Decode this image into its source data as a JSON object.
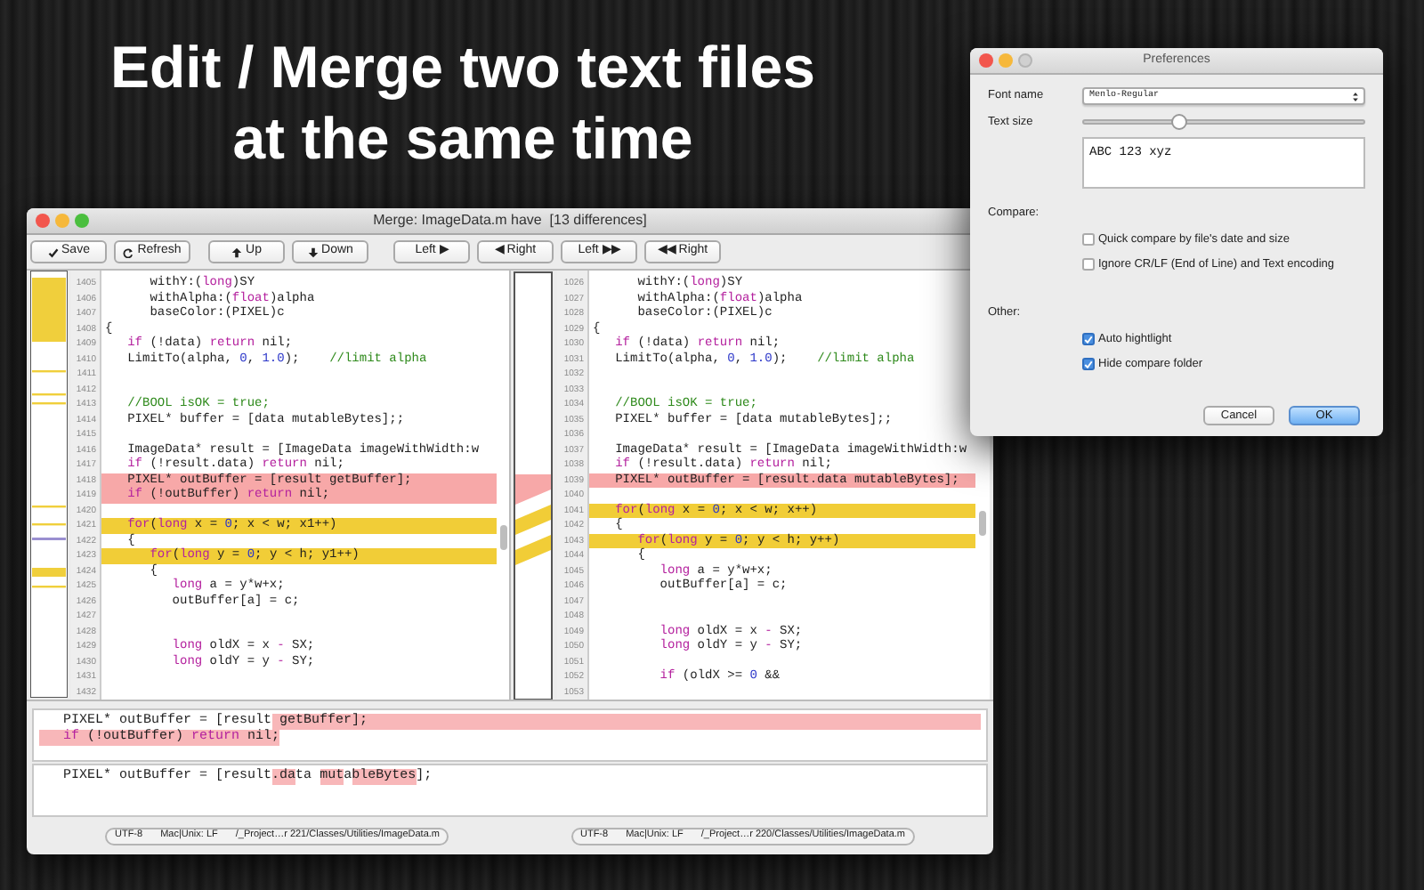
{
  "headline": [
    "Edit / Merge two text files",
    "at the same time"
  ],
  "window": {
    "title": "Merge: ImageData.m have  [13 differences]",
    "toolbar": [
      {
        "label": "Save"
      },
      {
        "label": "Refresh"
      },
      {
        "label": "Up"
      },
      {
        "label": "Down"
      },
      {
        "label": "Left ▶"
      },
      {
        "label": "◀ Right"
      },
      {
        "label": "Left ▶▶"
      },
      {
        "label": "◀◀ Right"
      }
    ],
    "left_pane": {
      "lines": [
        {
          "no": "1405",
          "code": [
            {
              "text": "      withY:("
            },
            {
              "text": "long",
              "kind": "keyword"
            },
            {
              "text": ")SY"
            }
          ]
        },
        {
          "no": "1406",
          "code": [
            {
              "text": "      withAlpha:("
            },
            {
              "text": "float",
              "kind": "keyword"
            },
            {
              "text": ")alpha"
            }
          ]
        },
        {
          "no": "1407",
          "code": [
            {
              "text": "      baseColor:(PIXEL)c"
            }
          ]
        },
        {
          "no": "1408",
          "code": [
            {
              "text": "{"
            }
          ]
        },
        {
          "no": "1409",
          "code": [
            {
              "text": "   if",
              "kind": "keyword"
            },
            {
              "text": " (!data) "
            },
            {
              "text": "return",
              "kind": "keyword"
            },
            {
              "text": " nil;"
            }
          ]
        },
        {
          "no": "1410",
          "code": [
            {
              "text": "   LimitTo(alpha, "
            },
            {
              "text": "0",
              "kind": "number"
            },
            {
              "text": ", "
            },
            {
              "text": "1.0",
              "kind": "number"
            },
            {
              "text": ");    "
            },
            {
              "text": "//limit alpha",
              "kind": "comment"
            }
          ]
        },
        {
          "no": "1411"
        },
        {
          "no": "1412"
        },
        {
          "no": "1413",
          "code": [
            {
              "text": "   //BOOL isOK = true;",
              "kind": "comment"
            }
          ]
        },
        {
          "no": "1414",
          "code": [
            {
              "text": "   PIXEL* buffer = [data mutableBytes];;"
            }
          ]
        },
        {
          "no": "1415"
        },
        {
          "no": "1416",
          "code": [
            {
              "text": "   ImageData* result = [ImageData imageWithWidth:w"
            }
          ]
        },
        {
          "no": "1417",
          "code": [
            {
              "text": "   if",
              "kind": "keyword"
            },
            {
              "text": " (!result.data) "
            },
            {
              "text": "return",
              "kind": "keyword"
            },
            {
              "text": " nil;"
            }
          ]
        },
        {
          "no": "1418",
          "kind": "removed",
          "code": [
            {
              "text": "   PIXEL* outBuffer = [result getBuffer];"
            }
          ]
        },
        {
          "no": "1419",
          "kind": "removed",
          "code": [
            {
              "text": "   if",
              "kind": "keyword"
            },
            {
              "text": " (!outBuffer) "
            },
            {
              "text": "return",
              "kind": "keyword"
            },
            {
              "text": " nil;"
            }
          ]
        },
        {
          "no": "1420"
        },
        {
          "no": "1421",
          "kind": "changed",
          "code": [
            {
              "text": "   for",
              "kind": "keyword"
            },
            {
              "text": "("
            },
            {
              "text": "long",
              "kind": "keyword"
            },
            {
              "text": " x = "
            },
            {
              "text": "0",
              "kind": "number"
            },
            {
              "text": "; x < w; x1++)"
            }
          ]
        },
        {
          "no": "1422",
          "code": [
            {
              "text": "   {"
            }
          ]
        },
        {
          "no": "1423",
          "kind": "changed",
          "code": [
            {
              "text": "      for",
              "kind": "keyword"
            },
            {
              "text": "("
            },
            {
              "text": "long",
              "kind": "keyword"
            },
            {
              "text": " y = "
            },
            {
              "text": "0",
              "kind": "number"
            },
            {
              "text": "; y < h; y1++)"
            }
          ]
        },
        {
          "no": "1424",
          "code": [
            {
              "text": "      {"
            }
          ]
        },
        {
          "no": "1425",
          "code": [
            {
              "text": "         long",
              "kind": "keyword"
            },
            {
              "text": " a = y*w+x;"
            }
          ]
        },
        {
          "no": "1426",
          "code": [
            {
              "text": "         outBuffer[a] = c;"
            }
          ]
        },
        {
          "no": "1427"
        },
        {
          "no": "1428"
        },
        {
          "no": "1429",
          "code": [
            {
              "text": "         long",
              "kind": "keyword"
            },
            {
              "text": " oldX = x "
            },
            {
              "text": "-",
              "kind": "keyword"
            },
            {
              "text": " SX;"
            }
          ]
        },
        {
          "no": "1430",
          "code": [
            {
              "text": "         long",
              "kind": "keyword"
            },
            {
              "text": " oldY = y "
            },
            {
              "text": "-",
              "kind": "keyword"
            },
            {
              "text": " SY;"
            }
          ]
        },
        {
          "no": "1431"
        },
        {
          "no": "1432"
        }
      ]
    },
    "right_pane": {
      "lines": [
        {
          "no": "1026",
          "code": [
            {
              "text": "      withY:("
            },
            {
              "text": "long",
              "kind": "keyword"
            },
            {
              "text": ")SY"
            }
          ]
        },
        {
          "no": "1027",
          "code": [
            {
              "text": "      withAlpha:("
            },
            {
              "text": "float",
              "kind": "keyword"
            },
            {
              "text": ")alpha"
            }
          ]
        },
        {
          "no": "1028",
          "code": [
            {
              "text": "      baseColor:(PIXEL)c"
            }
          ]
        },
        {
          "no": "1029",
          "code": [
            {
              "text": "{"
            }
          ]
        },
        {
          "no": "1030",
          "code": [
            {
              "text": "   if",
              "kind": "keyword"
            },
            {
              "text": " (!data) "
            },
            {
              "text": "return",
              "kind": "keyword"
            },
            {
              "text": " nil;"
            }
          ]
        },
        {
          "no": "1031",
          "code": [
            {
              "text": "   LimitTo(alpha, "
            },
            {
              "text": "0",
              "kind": "number"
            },
            {
              "text": ", "
            },
            {
              "text": "1.0",
              "kind": "number"
            },
            {
              "text": ");    "
            },
            {
              "text": "//limit alpha",
              "kind": "comment"
            }
          ]
        },
        {
          "no": "1032"
        },
        {
          "no": "1033"
        },
        {
          "no": "1034",
          "code": [
            {
              "text": "   //BOOL isOK = true;",
              "kind": "comment"
            }
          ]
        },
        {
          "no": "1035",
          "code": [
            {
              "text": "   PIXEL* buffer = [data mutableBytes];;"
            }
          ]
        },
        {
          "no": "1036"
        },
        {
          "no": "1037",
          "code": [
            {
              "text": "   ImageData* result = [ImageData imageWithWidth:w"
            }
          ]
        },
        {
          "no": "1038",
          "code": [
            {
              "text": "   if",
              "kind": "keyword"
            },
            {
              "text": " (!result.data) "
            },
            {
              "text": "return",
              "kind": "keyword"
            },
            {
              "text": " nil;"
            }
          ]
        },
        {
          "no": "1039",
          "kind": "removed",
          "code": [
            {
              "text": "   PIXEL* outBuffer = [result.data mutableBytes];"
            }
          ]
        },
        {
          "no": "1040"
        },
        {
          "no": "1041",
          "kind": "changed",
          "code": [
            {
              "text": "   for",
              "kind": "keyword"
            },
            {
              "text": "("
            },
            {
              "text": "long",
              "kind": "keyword"
            },
            {
              "text": " x = "
            },
            {
              "text": "0",
              "kind": "number"
            },
            {
              "text": "; x < w; x++)"
            }
          ]
        },
        {
          "no": "1042",
          "code": [
            {
              "text": "   {"
            }
          ]
        },
        {
          "no": "1043",
          "kind": "changed",
          "code": [
            {
              "text": "      for",
              "kind": "keyword"
            },
            {
              "text": "("
            },
            {
              "text": "long",
              "kind": "keyword"
            },
            {
              "text": " y = "
            },
            {
              "text": "0",
              "kind": "number"
            },
            {
              "text": "; y < h; y++)"
            }
          ]
        },
        {
          "no": "1044",
          "code": [
            {
              "text": "      {"
            }
          ]
        },
        {
          "no": "1045",
          "code": [
            {
              "text": "         long",
              "kind": "keyword"
            },
            {
              "text": " a = y*w+x;"
            }
          ]
        },
        {
          "no": "1046",
          "code": [
            {
              "text": "         outBuffer[a] = c;"
            }
          ]
        },
        {
          "no": "1047"
        },
        {
          "no": "1048"
        },
        {
          "no": "1049",
          "code": [
            {
              "text": "         long",
              "kind": "keyword"
            },
            {
              "text": " oldX = x "
            },
            {
              "text": "-",
              "kind": "keyword"
            },
            {
              "text": " SX;"
            }
          ]
        },
        {
          "no": "1050",
          "code": [
            {
              "text": "         long",
              "kind": "keyword"
            },
            {
              "text": " oldY = y "
            },
            {
              "text": "-",
              "kind": "keyword"
            },
            {
              "text": " SY;"
            }
          ]
        },
        {
          "no": "1051"
        },
        {
          "no": "1052",
          "code": [
            {
              "text": "         if",
              "kind": "keyword"
            },
            {
              "text": " (oldX >= "
            },
            {
              "text": "0",
              "kind": "number"
            },
            {
              "text": " &&"
            }
          ]
        },
        {
          "no": "1053"
        }
      ]
    },
    "detail_panes": [
      {
        "lines": [
          {
            "highlighted_to_end": true,
            "code": [
              {
                "text": "   PIXEL* outBuffer = [result"
              },
              {
                "text": " getBuffer];",
                "highlighted": true
              }
            ]
          },
          {
            "code": [
              {
                "text": "   if",
                "kind": "keyword",
                "highlighted": true
              },
              {
                "text": " (!outBuffer) ",
                "highlighted": true
              },
              {
                "text": "return",
                "kind": "keyword",
                "highlighted": true
              },
              {
                "text": " nil;",
                "highlighted": true
              }
            ]
          }
        ]
      },
      {
        "lines": [
          {
            "code": [
              {
                "text": "   PIXEL* outBuffer = [result"
              },
              {
                "text": ".da",
                "highlighted": true
              },
              {
                "text": "ta "
              },
              {
                "text": "mut",
                "highlighted": true
              },
              {
                "text": "a"
              },
              {
                "text": "bleBytes",
                "highlighted": true
              },
              {
                "text": "];"
              }
            ]
          }
        ]
      }
    ],
    "status_bars": [
      {
        "encoding": "UTF-8",
        "line_endings": "Mac|Unix: LF",
        "path": "/_Project…r 221/Classes/Utilities/ImageData.m"
      },
      {
        "encoding": "UTF-8",
        "line_endings": "Mac|Unix: LF",
        "path": "/_Project…r 220/Classes/Utilities/ImageData.m"
      }
    ]
  },
  "preferences": {
    "title": "Preferences",
    "font_name": {
      "label": "Font name",
      "value": "Menlo-Regular"
    },
    "text_size": {
      "label": "Text size",
      "level": 0.34
    },
    "preview": "ABC 123 xyz",
    "sections": [
      {
        "label": "Compare:",
        "options": [
          {
            "label": "Quick compare by file's date and size",
            "checked": false
          },
          {
            "label": "Ignore CR/LF (End of Line) and Text encoding",
            "checked": false
          }
        ]
      },
      {
        "label": "Other:",
        "options": [
          {
            "label": "Auto hightlight",
            "checked": true
          },
          {
            "label": "Hide compare folder",
            "checked": true
          }
        ]
      }
    ],
    "buttons": [
      {
        "label": "Cancel",
        "default": false
      },
      {
        "label": "OK",
        "default": true
      }
    ]
  }
}
